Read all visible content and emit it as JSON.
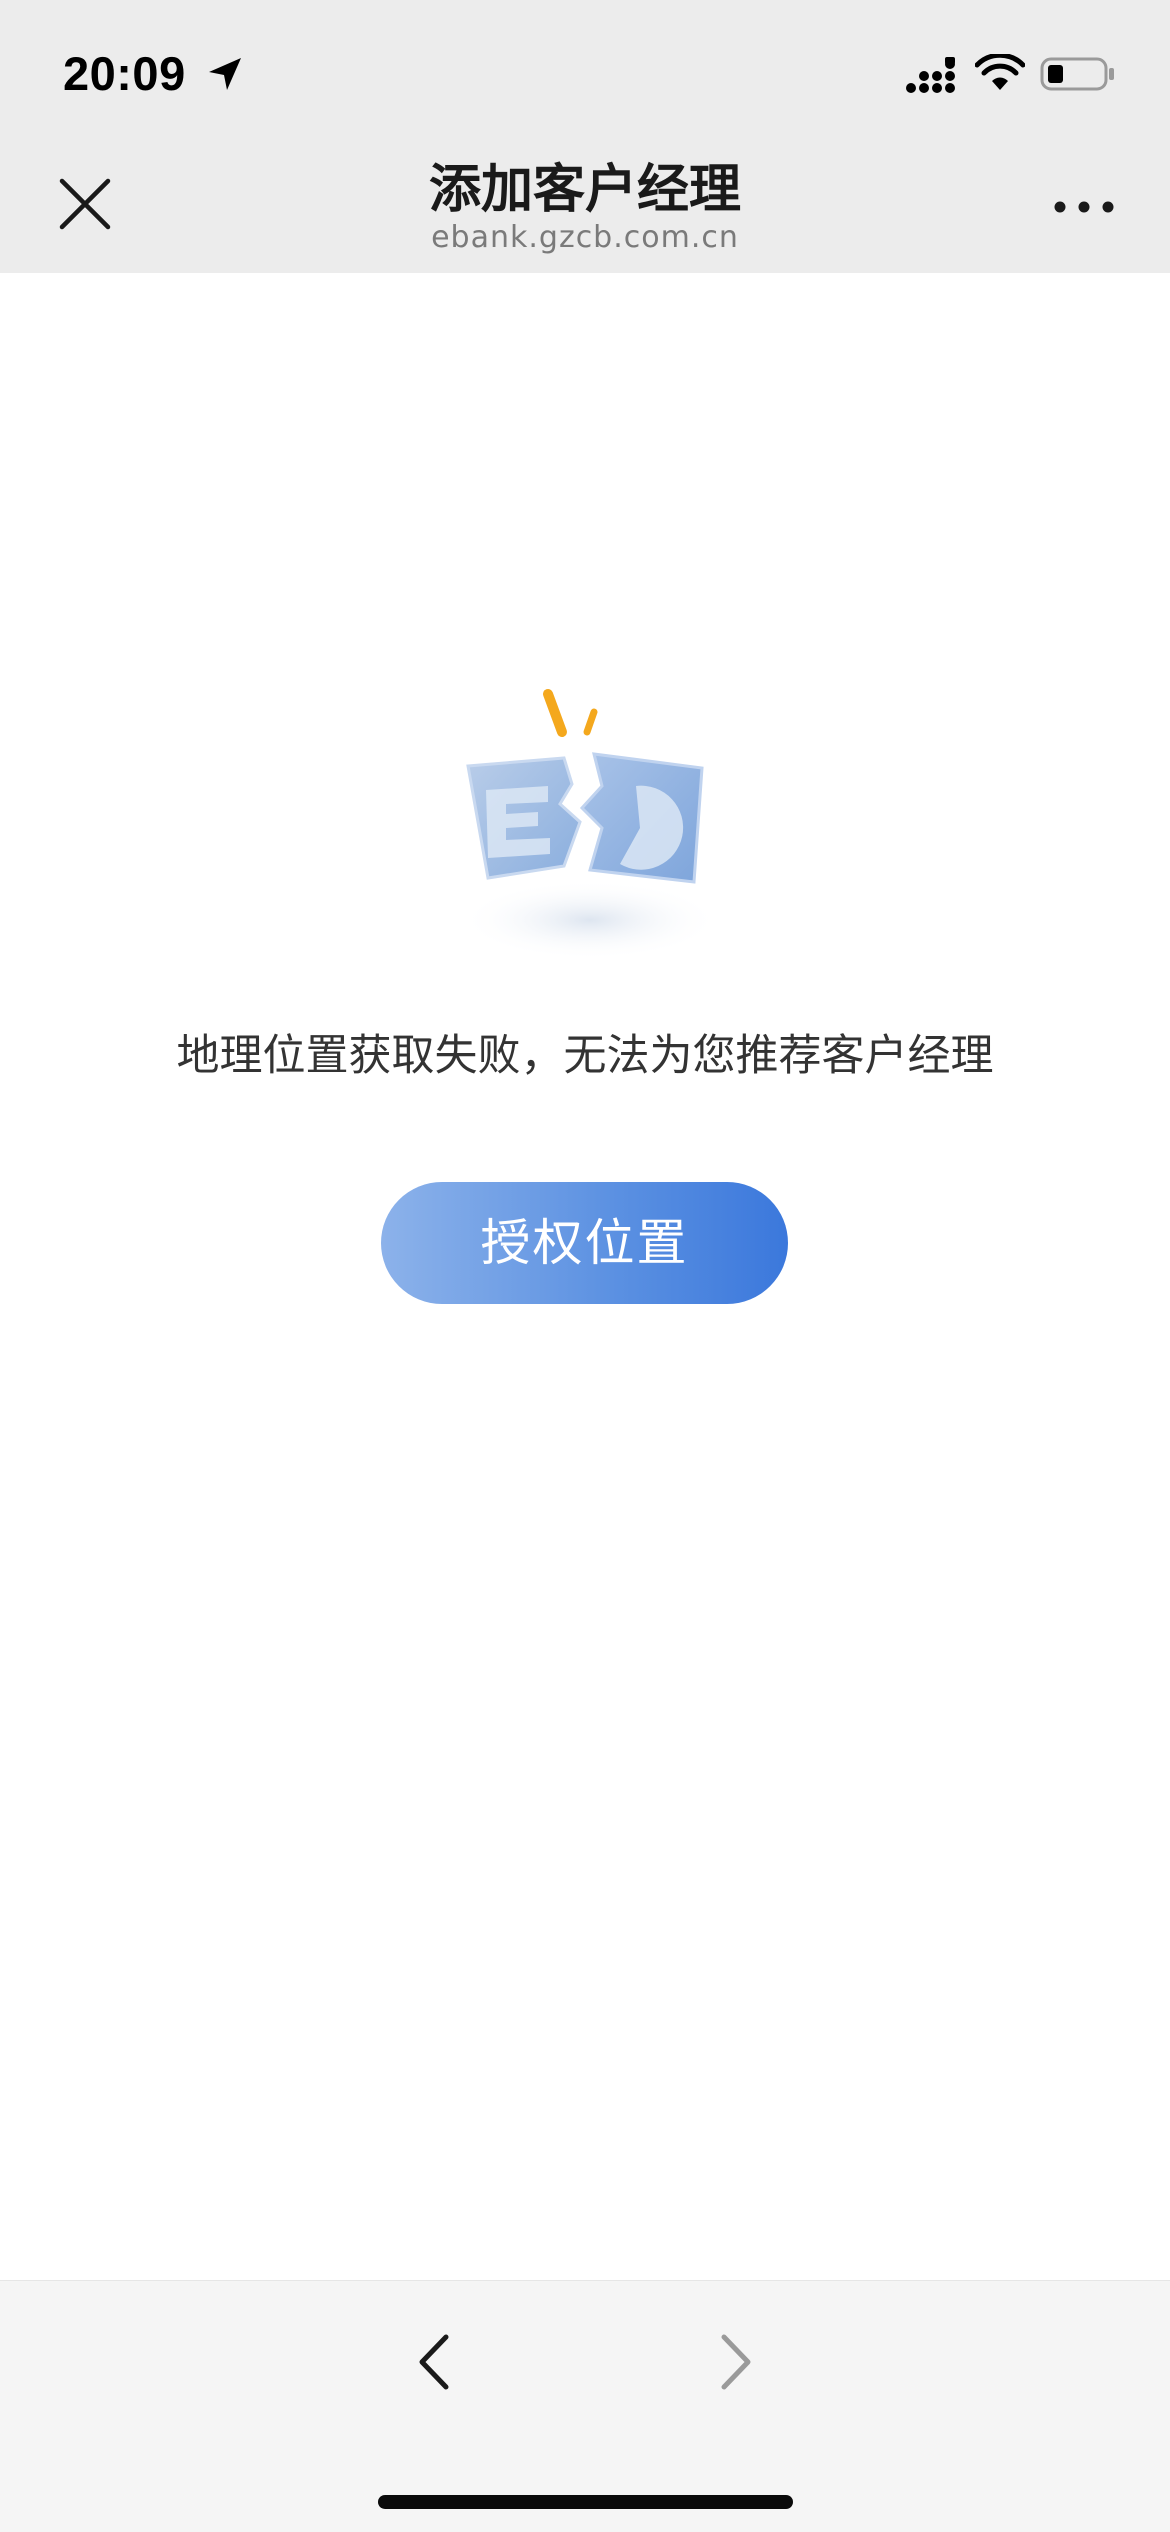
{
  "status_bar": {
    "time": "20:09",
    "icons": [
      "location-arrow-icon",
      "cellular-signal-icon",
      "wifi-icon",
      "battery-icon"
    ]
  },
  "nav": {
    "title": "添加客户经理",
    "url": "ebank.gzcb.com.cn",
    "close_icon": "close-icon",
    "more_icon": "more-icon"
  },
  "content": {
    "illustration_icon": "broken-document-icon",
    "message": "地理位置获取失败，无法为您推荐客户经理",
    "auth_button_label": "授权位置"
  },
  "toolbar": {
    "back_icon": "chevron-left-icon",
    "forward_icon": "chevron-right-icon"
  },
  "colors": {
    "nav_background": "#ececec",
    "button_gradient_start": "#8cb2ea",
    "button_gradient_end": "#3b78dc",
    "message_text": "#333333",
    "toolbar_background": "#f5f5f5"
  }
}
